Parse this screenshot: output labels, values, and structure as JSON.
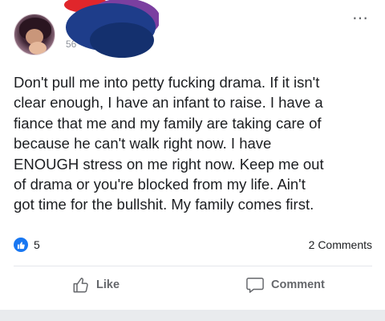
{
  "post": {
    "author_meta_partial": "56",
    "more_icon": "ellipsis-horizontal-icon",
    "text": "Don't pull me into petty fucking drama. If it isn't\nclear enough, I have an infant to raise. I have a\nfiance that me and my family are taking care of\nbecause he can't walk right now. I have\nENOUGH stress on me right now. Keep me out\nof drama or you're blocked from my life. Ain't\ngot time for the bullshit. My family comes first."
  },
  "engagement": {
    "reaction_icon": "thumbs-up-icon",
    "reaction_count": "5",
    "comments_count": "2 Comments"
  },
  "actions": {
    "like_label": "Like",
    "comment_label": "Comment"
  },
  "colors": {
    "accent_blue": "#1877f2",
    "text_primary": "#1c1e21",
    "text_secondary": "#65676b",
    "scribble_blue": "#1e3d8a",
    "scribble_purple": "#7b3fa0",
    "scribble_red": "#e0262b"
  }
}
